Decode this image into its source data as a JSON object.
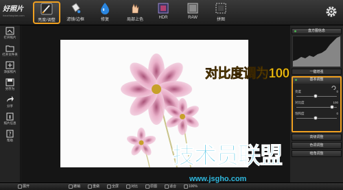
{
  "app": {
    "name": "好照片",
    "url": "haozhaopian.com"
  },
  "toolbar": {
    "tools": [
      {
        "id": "brightness",
        "label": "亮度/调整",
        "active": true
      },
      {
        "id": "filter",
        "label": "滤镜/边框",
        "active": false
      },
      {
        "id": "remove",
        "label": "修复",
        "active": false
      },
      {
        "id": "color",
        "label": "局部上色",
        "active": false
      },
      {
        "id": "hdr",
        "label": "HDR",
        "active": false
      },
      {
        "id": "raw",
        "label": "RAW",
        "active": false
      },
      {
        "id": "crop",
        "label": "拼图",
        "active": false
      }
    ]
  },
  "sidebar": {
    "items": [
      {
        "label": "打开照片",
        "icon": "open-photo-icon"
      },
      {
        "label": "打开文件夹",
        "icon": "open-folder-icon"
      },
      {
        "label": "添加照片",
        "icon": "add-photo-icon"
      },
      {
        "label": "另存为",
        "icon": "save-as-icon"
      },
      {
        "label": "分享",
        "icon": "share-icon"
      },
      {
        "label": "照片信息",
        "icon": "info-icon"
      },
      {
        "label": "帮助",
        "icon": "help-icon"
      }
    ]
  },
  "canvas": {
    "callout": "对比度调为100",
    "watermark": "技术员联盟",
    "watermark_url": "www.jsgho.com"
  },
  "panel": {
    "histogram_title": "直方图信息",
    "quick_label": "一键增强",
    "basic_title": "基本调整",
    "sliders": [
      {
        "label": "亮度",
        "value": "0",
        "level": 0.5
      },
      {
        "label": "对比度",
        "value": "100",
        "level": 1.0
      },
      {
        "label": "饱和度",
        "value": "0",
        "level": 0.5
      }
    ],
    "buttons": [
      "高级调整",
      "色调调整",
      "暗角调整"
    ]
  },
  "bottom": {
    "expand": "展开",
    "buttons": [
      "撤销",
      "重做",
      "全屏",
      "对比",
      "原图",
      "适合",
      "100%"
    ]
  },
  "colors": {
    "accent": "#f0a020",
    "callout": "#f0c010",
    "watermark": "#2fb8de"
  }
}
